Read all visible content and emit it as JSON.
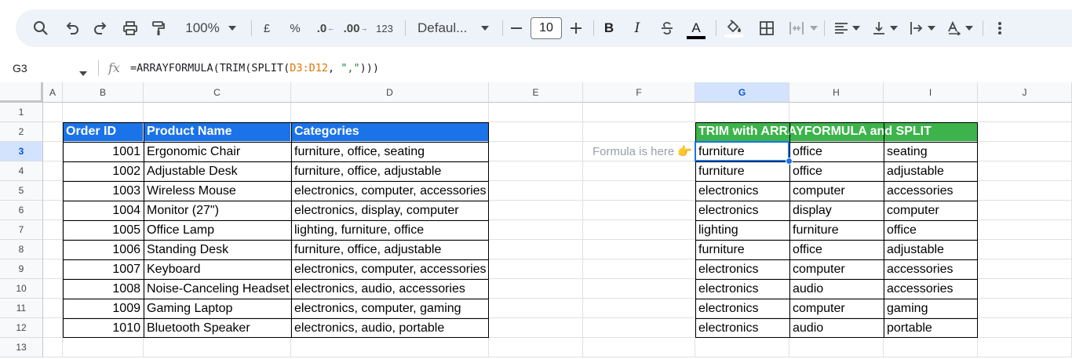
{
  "toolbar": {
    "zoom": "100%",
    "currency": "£",
    "percent": "%",
    "decrease_decimal": ".0",
    "increase_decimal": ".00",
    "more_formats": "123",
    "font": "Defaul...",
    "font_size": "10",
    "bold": "B",
    "italic": "I",
    "text_color": "A"
  },
  "formula_bar": {
    "cell_ref": "G3",
    "fx": "fx",
    "formula_prefix": "=ARRAYFORMULA(TRIM(SPLIT(",
    "formula_ref": "D3:D12",
    "formula_sep": ", ",
    "formula_str": "\",\"",
    "formula_suffix": ")))"
  },
  "columns": [
    "A",
    "B",
    "C",
    "D",
    "E",
    "F",
    "G",
    "H",
    "I",
    "J"
  ],
  "rows": [
    "1",
    "2",
    "3",
    "4",
    "5",
    "6",
    "7",
    "8",
    "9",
    "10",
    "11",
    "12",
    "13"
  ],
  "table1": {
    "headers": [
      "Order ID",
      "Product Name",
      "Categories"
    ],
    "rows": [
      [
        "1001",
        "Ergonomic Chair",
        "furniture, office, seating"
      ],
      [
        "1002",
        "Adjustable Desk",
        "furniture, office, adjustable"
      ],
      [
        "1003",
        "Wireless Mouse",
        "electronics, computer, accessories"
      ],
      [
        "1004",
        "Monitor (27\")",
        "electronics, display, computer"
      ],
      [
        "1005",
        "Office Lamp",
        "lighting, furniture, office"
      ],
      [
        "1006",
        "Standing Desk",
        "furniture, office, adjustable"
      ],
      [
        "1007",
        "Keyboard",
        "electronics, computer, accessories"
      ],
      [
        "1008",
        "Noise-Canceling Headset",
        "electronics, audio, accessories"
      ],
      [
        "1009",
        "Gaming Laptop",
        "electronics, computer, gaming"
      ],
      [
        "1010",
        "Bluetooth Speaker",
        "electronics, audio, portable"
      ]
    ]
  },
  "note": "Formula is here 👉",
  "table2": {
    "title": "TRIM with ARRAYFORMULA and SPLIT",
    "rows": [
      [
        "furniture",
        "office",
        "seating"
      ],
      [
        "furniture",
        "office",
        "adjustable"
      ],
      [
        "electronics",
        "computer",
        "accessories"
      ],
      [
        "electronics",
        "display",
        "computer"
      ],
      [
        "lighting",
        "furniture",
        "office"
      ],
      [
        "furniture",
        "office",
        "adjustable"
      ],
      [
        "electronics",
        "computer",
        "accessories"
      ],
      [
        "electronics",
        "audio",
        "accessories"
      ],
      [
        "electronics",
        "computer",
        "gaming"
      ],
      [
        "electronics",
        "audio",
        "portable"
      ]
    ]
  },
  "colors": {
    "header_blue": "#1a73e8",
    "header_green": "#3cb44b",
    "selection": "#1a73e8"
  }
}
